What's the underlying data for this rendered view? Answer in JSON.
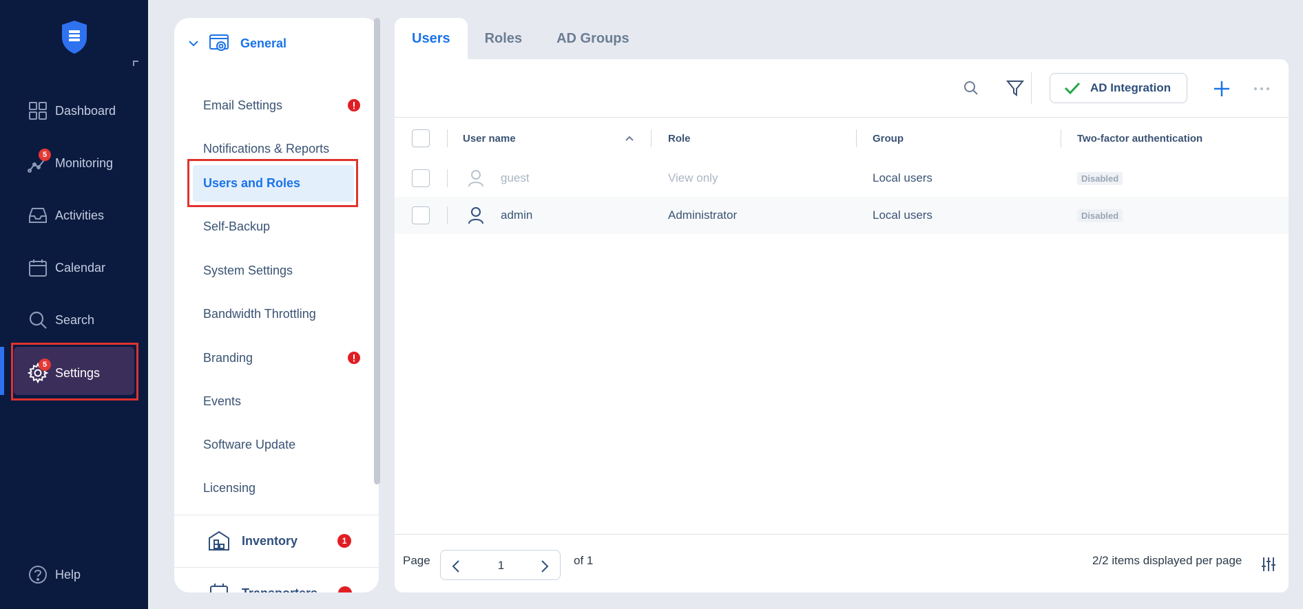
{
  "nav": {
    "items": [
      {
        "label": "Dashboard",
        "icon": "dashboard-icon"
      },
      {
        "label": "Monitoring",
        "icon": "monitoring-icon",
        "badge": "5"
      },
      {
        "label": "Activities",
        "icon": "activities-icon"
      },
      {
        "label": "Calendar",
        "icon": "calendar-icon"
      },
      {
        "label": "Search",
        "icon": "search-icon"
      },
      {
        "label": "Settings",
        "icon": "gear-icon",
        "badge": "5",
        "active": true
      }
    ],
    "help": "Help"
  },
  "submenu": {
    "section": "General",
    "items": [
      {
        "label": "Email Settings",
        "warning": true
      },
      {
        "label": "Notifications & Reports"
      },
      {
        "label": "Users and Roles",
        "active": true
      },
      {
        "label": "Self-Backup"
      },
      {
        "label": "System Settings"
      },
      {
        "label": "Bandwidth Throttling"
      },
      {
        "label": "Branding",
        "warning": true
      },
      {
        "label": "Events"
      },
      {
        "label": "Software Update"
      },
      {
        "label": "Licensing"
      }
    ],
    "inventory": {
      "label": "Inventory",
      "badge": "1"
    },
    "transporters": {
      "label": "Transporters"
    }
  },
  "tabs": [
    {
      "label": "Users",
      "active": true
    },
    {
      "label": "Roles"
    },
    {
      "label": "AD Groups"
    }
  ],
  "toolbar": {
    "ad_integration": "AD Integration"
  },
  "table": {
    "columns": [
      "User name",
      "Role",
      "Group",
      "Two-factor authentication"
    ],
    "rows": [
      {
        "user": "guest",
        "role": "View only",
        "group": "Local users",
        "tfa": "Disabled",
        "disabled": true
      },
      {
        "user": "admin",
        "role": "Administrator",
        "group": "Local users",
        "tfa": "Disabled"
      }
    ]
  },
  "pagination": {
    "page_label": "Page",
    "page": "1",
    "of_label": "of 1",
    "items_label": "2/2 items displayed per page"
  },
  "colors": {
    "accent": "#1a73e8",
    "nav_bg": "#0b1a3f",
    "badge": "#e53935",
    "highlight": "#e0332f",
    "success": "#22a84a"
  }
}
